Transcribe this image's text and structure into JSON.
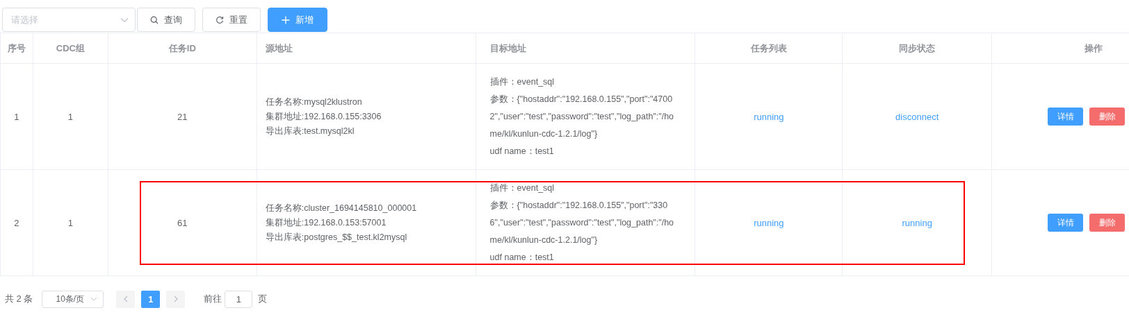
{
  "toolbar": {
    "select": {
      "placeholder": "请选择"
    },
    "buttons": [
      {
        "kind": "search",
        "label": "查询"
      },
      {
        "kind": "reset",
        "label": "重置"
      },
      {
        "kind": "add",
        "label": "新增"
      }
    ]
  },
  "table": {
    "columns": [
      "序号",
      "CDC组",
      "任务ID",
      "源地址",
      "目标地址",
      "任务列表",
      "同步状态",
      "操作"
    ],
    "rows": [
      {
        "index": "1",
        "cdc_group": "1",
        "task_id": "21",
        "source": [
          "任务名称:mysql2klustron",
          "集群地址:192.168.0.155:3306",
          "导出库表:test.mysql2kl"
        ],
        "target": [
          "插件：event_sql",
          "参数：{\"hostaddr\":\"192.168.0.155\",\"port\":\"47002\",\"user\":\"test\",\"password\":\"test\",\"log_path\":\"/home/kl/kunlun-cdc-1.2.1/log\"}",
          "udf name：test1"
        ],
        "task_list": "running",
        "sync_status": "disconnect",
        "actions": [
          "详情",
          "删除"
        ],
        "highlighted": false
      },
      {
        "index": "2",
        "cdc_group": "1",
        "task_id": "61",
        "source": [
          "任务名称:cluster_1694145810_000001",
          "集群地址:192.168.0.153:57001",
          "导出库表:postgres_$$_test.kl2mysql"
        ],
        "target": [
          "插件：event_sql",
          "参数：{\"hostaddr\":\"192.168.0.155\",\"port\":\"3306\",\"user\":\"test\",\"password\":\"test\",\"log_path\":\"/home/kl/kunlun-cdc-1.2.1/log\"}",
          "udf name：test1"
        ],
        "task_list": "running",
        "sync_status": "running",
        "actions": [
          "详情",
          "删除"
        ],
        "highlighted": true
      }
    ]
  },
  "pagination": {
    "total": "共 2 条",
    "page_size": "10条/页",
    "pages": [
      {
        "label": "1",
        "selected": true
      }
    ],
    "goto_label": "前往",
    "goto_value": "1",
    "page_suffix": "页"
  }
}
